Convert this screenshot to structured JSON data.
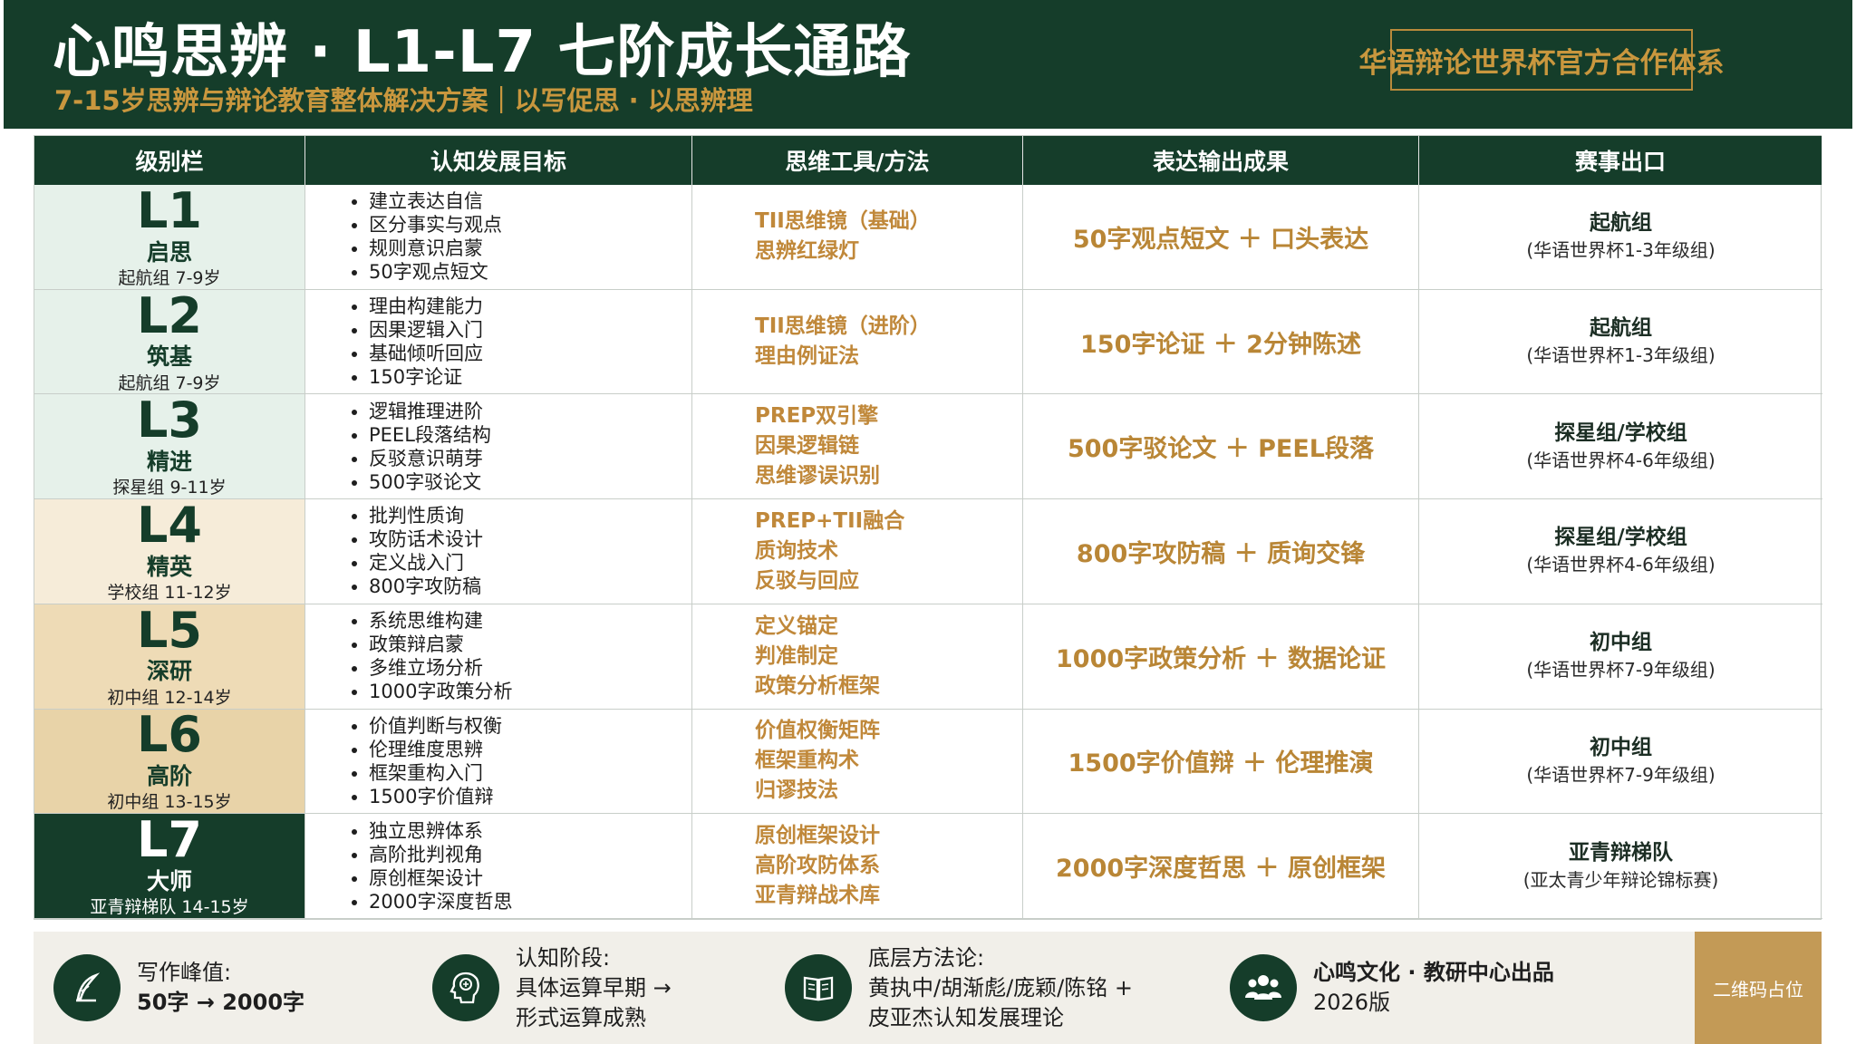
{
  "header": {
    "title": "心鸣思辨 · L1-L7 七阶成长通路",
    "subtitle": "7-15岁思辨与辩论教育整体解决方案｜以写促思 · 以思辨理",
    "partner": "华语辩论世界杯官方合作体系"
  },
  "table": {
    "headers": [
      "级别栏",
      "认知发展目标",
      "思维工具/方法",
      "表达输出成果",
      "赛事出口"
    ],
    "rows": [
      {
        "code": "L1",
        "name": "启思",
        "age": "起航组 7-9岁",
        "bg": "#e6f1ea",
        "goals": [
          "建立表达自信",
          "区分事实与观点",
          "规则意识启蒙",
          "50字观点短文"
        ],
        "tools": [
          "TII思维镜（基础）",
          "思辨红绿灯"
        ],
        "output": "50字观点短文 ＋ 口头表达",
        "exit_group": "起航组",
        "exit_note": "(华语世界杯1-3年级组)"
      },
      {
        "code": "L2",
        "name": "筑基",
        "age": "起航组 7-9岁",
        "bg": "#e6f1ea",
        "goals": [
          "理由构建能力",
          "因果逻辑入门",
          "基础倾听回应",
          "150字论证"
        ],
        "tools": [
          "TII思维镜（进阶）",
          "理由例证法"
        ],
        "output": "150字论证 ＋ 2分钟陈述",
        "exit_group": "起航组",
        "exit_note": "(华语世界杯1-3年级组)"
      },
      {
        "code": "L3",
        "name": "精进",
        "age": "探星组 9-11岁",
        "bg": "#e6f1ea",
        "goals": [
          "逻辑推理进阶",
          "PEEL段落结构",
          "反驳意识萌芽",
          "500字驳论文"
        ],
        "tools": [
          "PREP双引擎",
          "因果逻辑链",
          "思维谬误识别"
        ],
        "output": "500字驳论文 ＋ PEEL段落",
        "exit_group": "探星组/学校组",
        "exit_note": "(华语世界杯4-6年级组)"
      },
      {
        "code": "L4",
        "name": "精英",
        "age": "学校组 11-12岁",
        "bg": "#f6ecd9",
        "goals": [
          "批判性质询",
          "攻防话术设计",
          "定义战入门",
          "800字攻防稿"
        ],
        "tools": [
          "PREP+TII融合",
          "质询技术",
          "反驳与回应"
        ],
        "output": "800字攻防稿 ＋ 质询交锋",
        "exit_group": "探星组/学校组",
        "exit_note": "(华语世界杯4-6年级组)"
      },
      {
        "code": "L5",
        "name": "深研",
        "age": "初中组 12-14岁",
        "bg": "#eedbb6",
        "goals": [
          "系统思维构建",
          "政策辩启蒙",
          "多维立场分析",
          "1000字政策分析"
        ],
        "tools": [
          "定义锚定",
          "判准制定",
          "政策分析框架"
        ],
        "output": "1000字政策分析 ＋ 数据论证",
        "exit_group": "初中组",
        "exit_note": "(华语世界杯7-9年级组)"
      },
      {
        "code": "L6",
        "name": "高阶",
        "age": "初中组 13-15岁",
        "bg": "#e8d3a8",
        "goals": [
          "价值判断与权衡",
          "伦理维度思辨",
          "框架重构入门",
          "1500字价值辩"
        ],
        "tools": [
          "价值权衡矩阵",
          "框架重构术",
          "归谬技法"
        ],
        "output": "1500字价值辩 ＋ 伦理推演",
        "exit_group": "初中组",
        "exit_note": "(华语世界杯7-9年级组)"
      },
      {
        "code": "L7",
        "name": "大师",
        "age": "亚青辩梯队 14-15岁",
        "bg": "#153d2a",
        "goals": [
          "独立思辨体系",
          "高阶批判视角",
          "原创框架设计",
          "2000字深度哲思"
        ],
        "tools": [
          "原创框架设计",
          "高阶攻防体系",
          "亚青辩战术库"
        ],
        "output": "2000字深度哲思 ＋ 原创框架",
        "exit_group": "亚青辩梯队",
        "exit_note": "(亚太青少年辩论锦标赛)"
      }
    ]
  },
  "footer": {
    "items": [
      {
        "icon": "quill-icon",
        "line1": "写作峰值:",
        "line2": "50字 → 2000字",
        "line3": ""
      },
      {
        "icon": "brain-head-icon",
        "line1": "认知阶段:",
        "line2": "具体运算早期 →",
        "line3": "形式运算成熟"
      },
      {
        "icon": "book-icon",
        "line1": "底层方法论:",
        "line2": "黄执中/胡渐彪/庞颖/陈铭 +",
        "line3": "皮亚杰认知发展理论"
      },
      {
        "icon": "team-icon",
        "line1": "心鸣文化 · 教研中心出品",
        "line2": "2026版",
        "line3": ""
      }
    ],
    "qr_placeholder": "二维码占位"
  },
  "colors": {
    "dark_green": "#153d2a",
    "gold": "#c0883a",
    "cream": "#f1efe9"
  }
}
